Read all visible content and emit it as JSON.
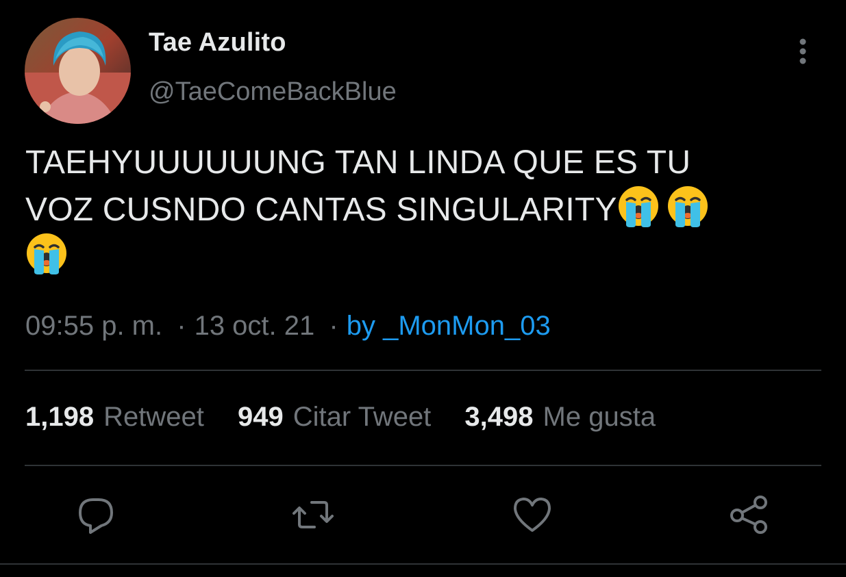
{
  "tweet": {
    "author": {
      "display_name": "Tae Azulito",
      "handle": "@TaeComeBackBlue"
    },
    "text_line1": "TAEHYUUUUUUNG TAN LINDA QUE ES TU",
    "text_line2": "VOZ CUSNDO CANTAS SINGULARITY",
    "emojis": [
      "loudly-crying-face-icon",
      "loudly-crying-face-icon",
      "loudly-crying-face-icon"
    ],
    "time": "09:55 p. m.",
    "date": "13 oct. 21",
    "separator": "·",
    "source": "by _MonMon_03"
  },
  "stats": {
    "retweets": {
      "count": "1,198",
      "label": "Retweet"
    },
    "quotes": {
      "count": "949",
      "label": "Citar Tweet"
    },
    "likes": {
      "count": "3,498",
      "label": "Me gusta"
    }
  },
  "actions": [
    "reply-icon",
    "retweet-icon",
    "like-icon",
    "share-icon"
  ],
  "colors": {
    "background": "#000000",
    "text": "#e7e9ea",
    "secondary_text": "#71767b",
    "link": "#1d9bf0",
    "divider": "#2f3336"
  }
}
